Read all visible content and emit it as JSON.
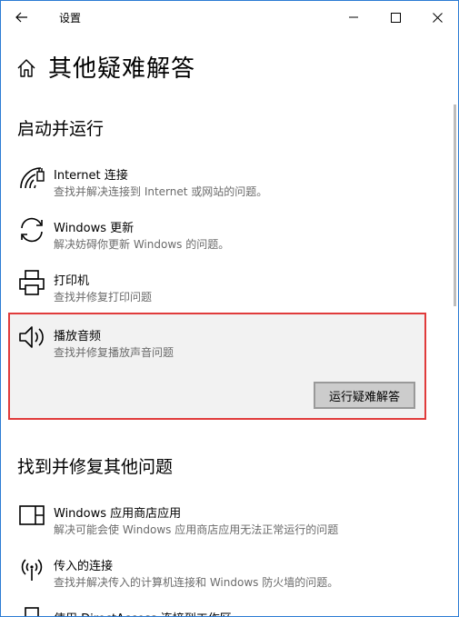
{
  "window": {
    "title": "设置"
  },
  "page": {
    "title": "其他疑难解答"
  },
  "sections": [
    {
      "title": "启动并运行"
    },
    {
      "title": "找到并修复其他问题"
    }
  ],
  "run_items": [
    {
      "icon": "wifi-icon",
      "title": "Internet 连接",
      "desc": "查找并解决连接到 Internet 或网站的问题。"
    },
    {
      "icon": "refresh-icon",
      "title": "Windows 更新",
      "desc": "解决妨碍你更新 Windows 的问题。"
    },
    {
      "icon": "printer-icon",
      "title": "打印机",
      "desc": "查找并修复打印问题"
    },
    {
      "icon": "speaker-icon",
      "title": "播放音频",
      "desc": "查找并修复播放声音问题",
      "button": "运行疑难解答"
    }
  ],
  "other_items": [
    {
      "icon": "window-split-icon",
      "title": "Windows 应用商店应用",
      "desc": "解决可能会使 Windows 应用商店应用无法正常运行的问题"
    },
    {
      "icon": "antenna-icon",
      "title": "传入的连接",
      "desc": "查找并解决传入的计算机连接和 Windows 防火墙的问题。"
    },
    {
      "icon": "workplace-icon",
      "title": "使用 DirectAccess 连接到工作区"
    }
  ]
}
